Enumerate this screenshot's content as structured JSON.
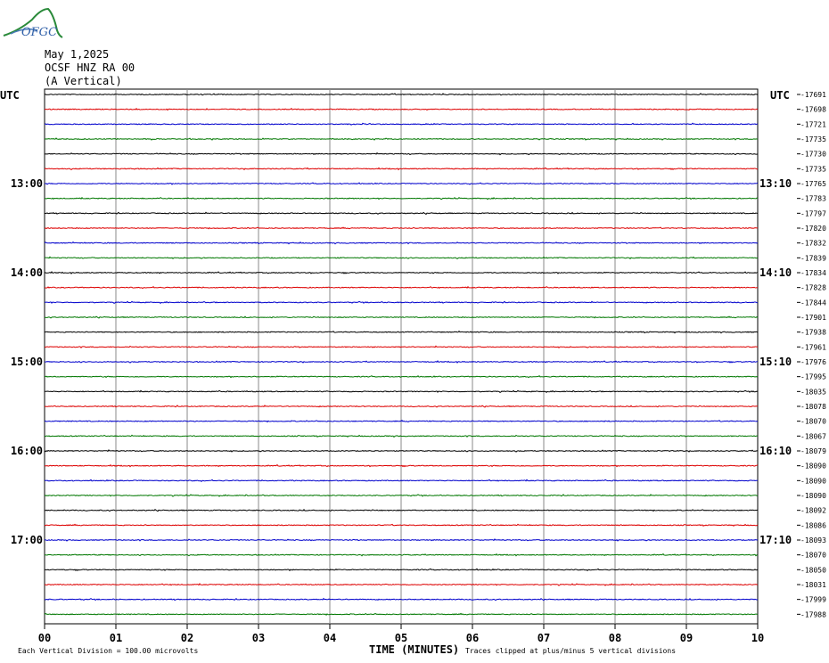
{
  "logo": {
    "text": "OFGC"
  },
  "header": {
    "date": "May 1,2025",
    "station": "OCSF HNZ RA 00",
    "component": "(A Vertical)"
  },
  "chart_data": {
    "type": "line",
    "title": "",
    "xlabel": "TIME (MINUTES)",
    "x_ticks": [
      "00",
      "01",
      "02",
      "03",
      "04",
      "05",
      "06",
      "07",
      "08",
      "09",
      "10"
    ],
    "xlim": [
      0,
      10
    ],
    "left_axis_label": "UTC",
    "right_axis_label": "UTC",
    "left_time_labels": [
      {
        "row": 6,
        "text": "13:00"
      },
      {
        "row": 12,
        "text": "14:00"
      },
      {
        "row": 18,
        "text": "15:00"
      },
      {
        "row": 24,
        "text": "16:00"
      },
      {
        "row": 30,
        "text": "17:00"
      }
    ],
    "right_time_labels": [
      {
        "row": 6,
        "text": "13:10"
      },
      {
        "row": 12,
        "text": "14:10"
      },
      {
        "row": 18,
        "text": "15:10"
      },
      {
        "row": 24,
        "text": "16:10"
      },
      {
        "row": 30,
        "text": "17:10"
      }
    ],
    "trace_colors": [
      "#000000",
      "#dd0000",
      "#0000cc",
      "#007700"
    ],
    "trace_count": 36,
    "trace_offsets": [
      "-17691",
      "-17698",
      "-17721",
      "-17735",
      "-17730",
      "-17735",
      "-17765",
      "-17783",
      "-17797",
      "-17820",
      "-17832",
      "-17839",
      "-17834",
      "-17828",
      "-17844",
      "-17901",
      "-17938",
      "-17961",
      "-17976",
      "-17995",
      "-18035",
      "-18078",
      "-18070",
      "-18067",
      "-18079",
      "-18090",
      "-18090",
      "-18090",
      "-18092",
      "-18086",
      "-18093",
      "-18070",
      "-18050",
      "-18031",
      "-17999",
      "-17988"
    ],
    "grid": true
  },
  "footer": {
    "scale_note": "Each Vertical Division =  100.00 microvolts",
    "clip_note": "Traces clipped at plus/minus 5 vertical divisions"
  }
}
